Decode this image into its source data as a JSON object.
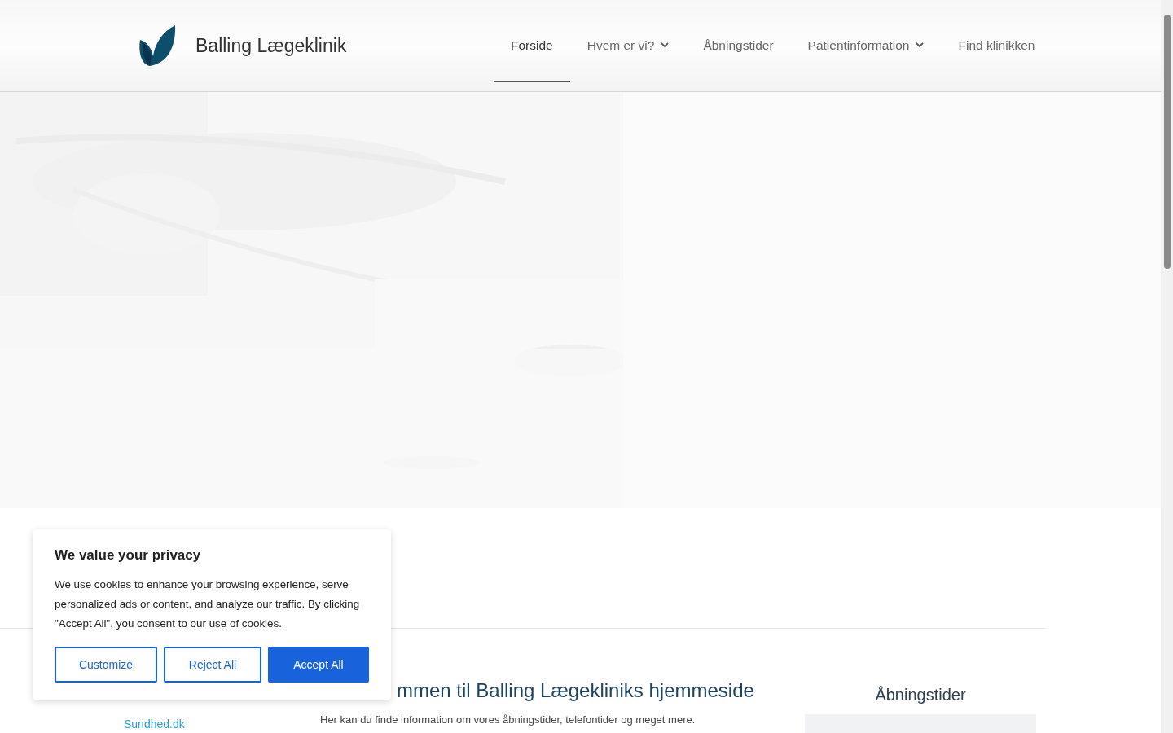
{
  "header": {
    "logo_text": "Balling Lægeklinik",
    "nav": [
      {
        "label": "Forside",
        "selected": true,
        "dropdown": false
      },
      {
        "label": "Hvem er vi?",
        "selected": false,
        "dropdown": true
      },
      {
        "label": "Åbningstider",
        "selected": false,
        "dropdown": false
      },
      {
        "label": "Patientinformation",
        "selected": false,
        "dropdown": true
      },
      {
        "label": "Find klinikken",
        "selected": false,
        "dropdown": false
      }
    ]
  },
  "sidebar": {
    "link": "Sundhed.dk"
  },
  "main": {
    "heading": "mmen til Balling Lægekliniks hjemmeside",
    "intro": "Her kan du finde information om vores åbningstider, telefontider og meget mere."
  },
  "opening_hours": {
    "heading": "Åbningstider"
  },
  "cookie_banner": {
    "title": "We value your privacy",
    "text": "We use cookies to enhance your browsing experience, serve personalized ads or content, and analyze our traffic. By clicking \"Accept All\", you consent to our use of cookies.",
    "buttons": [
      {
        "label": "Customize",
        "kind": "outline"
      },
      {
        "label": "Reject All",
        "kind": "outline"
      },
      {
        "label": "Accept All",
        "kind": "primary"
      }
    ]
  }
}
